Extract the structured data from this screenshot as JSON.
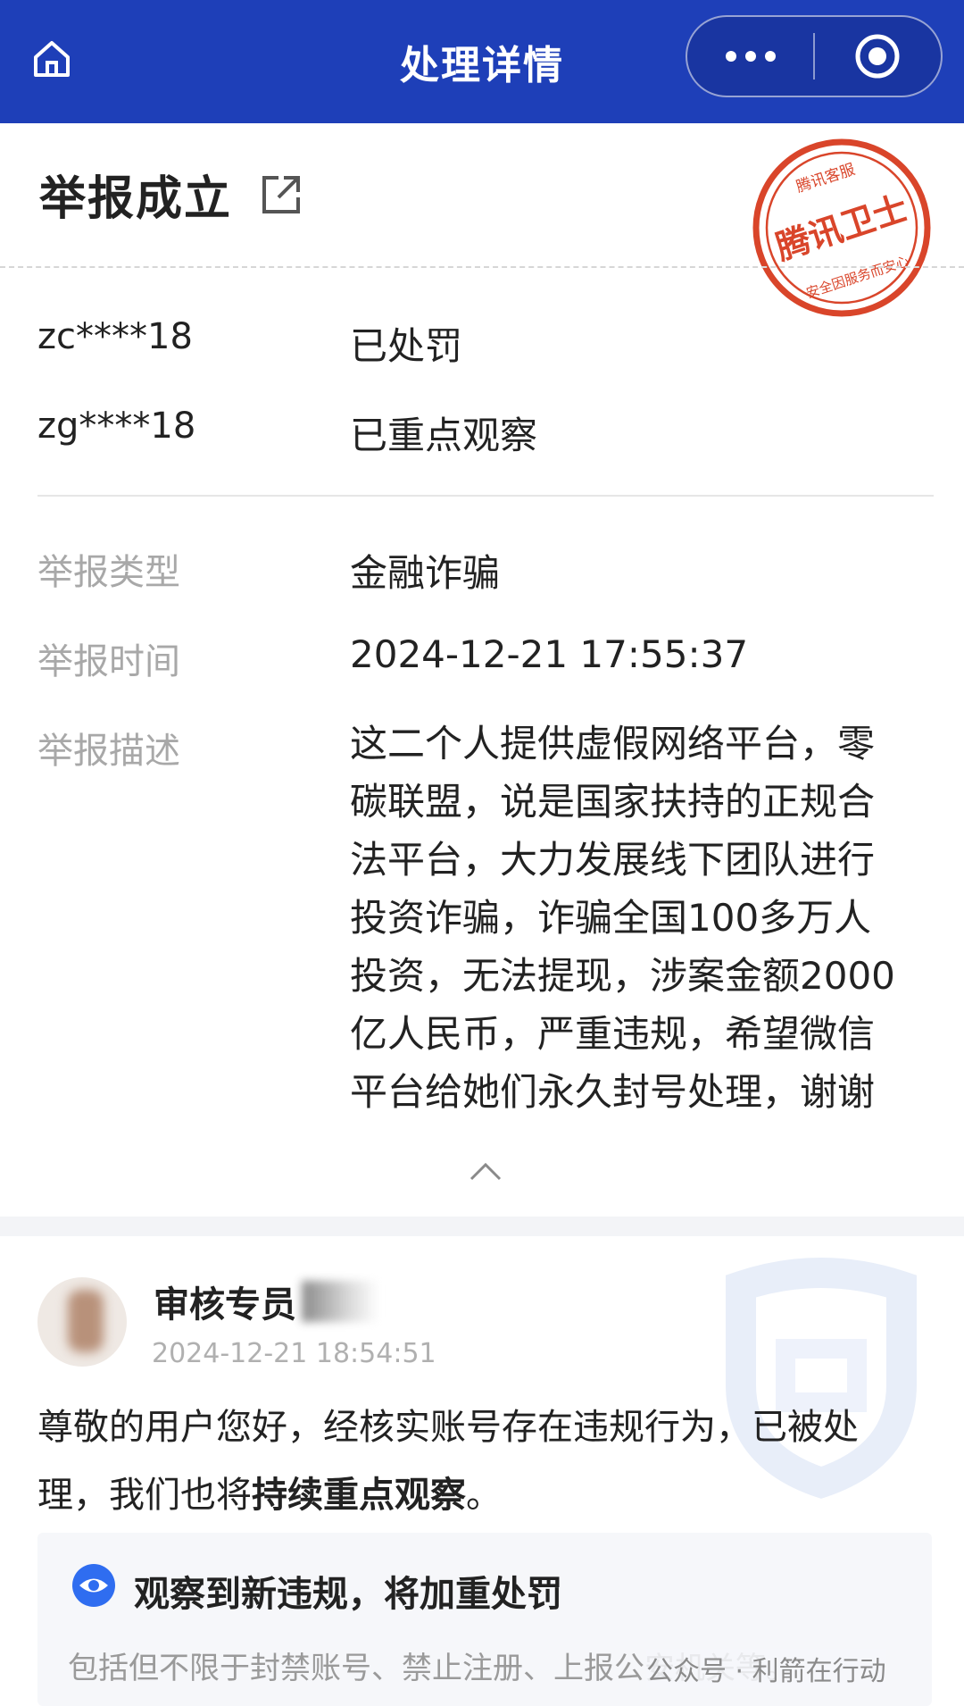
{
  "header": {
    "title": "处理详情",
    "home_icon": "home-icon",
    "more_icon": "more-dots-icon",
    "close_icon": "target-close-icon",
    "bg_color": "#1e3fb8"
  },
  "report": {
    "title": "举报成立",
    "stamp": {
      "top": "腾讯客服",
      "center": "腾讯卫士",
      "bottom": "安全因服务而安心",
      "color": "#d9452a"
    },
    "accounts": [
      {
        "id": "zc****18",
        "status": "已处罚"
      },
      {
        "id": "zg****18",
        "status": "已重点观察"
      }
    ],
    "type_label": "举报类型",
    "type_value": "金融诈骗",
    "time_label": "举报时间",
    "time_value": "2024-12-21 17:55:37",
    "desc_label": "举报描述",
    "desc_lines": [
      "这二个人提供虚假网络平台，零",
      "碳联盟，说是国家扶持的正规合",
      "法平台，大力发展线下团队进行",
      "投资诈骗，诈骗全国100多万人",
      "投资，无法提现，涉案金额2000",
      "亿人民币，严重违规，希望微信",
      "平台给她们永久封号处理，谢谢"
    ]
  },
  "review": {
    "name": "审核专员",
    "time": "2024-12-21 18:54:51",
    "reply_line1": "尊敬的用户您好，经核实账号存在违规行为，已被处",
    "reply_line2_a": "理，我们也将",
    "reply_line2_b": "持续重点观察",
    "reply_line2_c": "。",
    "notice_title": "观察到新违规，将加重处罚",
    "notice_sub": "包括但不限于封禁账号、禁止注册、上报公安机关等。",
    "watermark": "公众号 · 利箭在行动",
    "accent_color": "#2f6df0"
  }
}
